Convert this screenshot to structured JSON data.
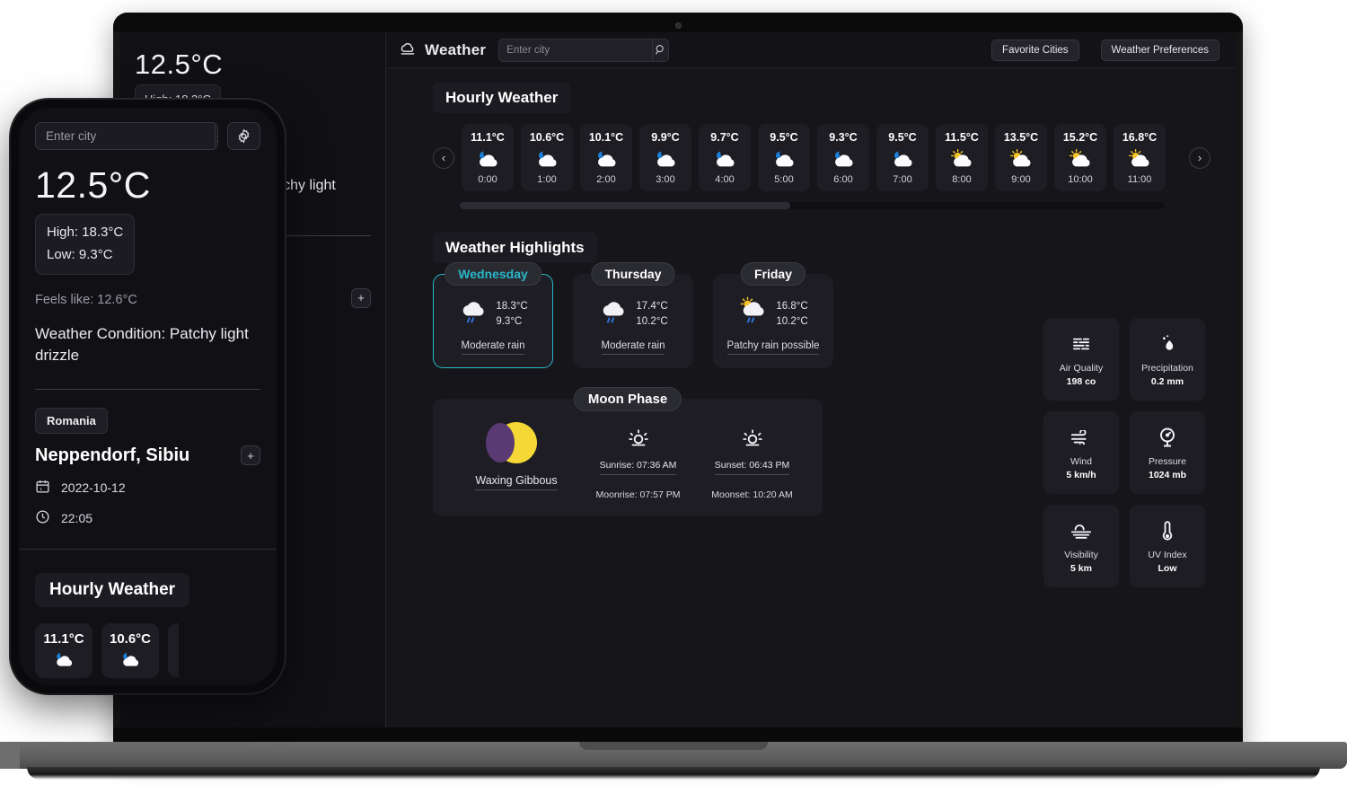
{
  "app": {
    "brand": "Weather",
    "brand_icon": "cloud-icon",
    "search": {
      "placeholder": "Enter city",
      "value": "",
      "icon": "search-icon"
    },
    "buttons": {
      "favorite_cities": "Favorite Cities",
      "weather_preferences": "Weather Preferences"
    }
  },
  "sidebar": {
    "temperature": "12.5°C",
    "high": "High: 18.3°C",
    "low": "Low: 9.3°C",
    "feels_like": "Feels like: 12.6°C",
    "condition": "Weather Condition: Patchy light drizzle",
    "country": "Romania",
    "city": "Neppendorf, Sibiu",
    "add_label": "+",
    "date": "2022-10-12",
    "time": "22:05",
    "calendar_icon": "calendar-icon",
    "clock_icon": "clock-icon"
  },
  "hourly": {
    "title": "Hourly Weather",
    "prev_label": "‹",
    "next_label": "›",
    "scroll_percent": 47,
    "items": [
      {
        "temp": "11.1°C",
        "time": "0:00",
        "icon": "moon-cloud-icon"
      },
      {
        "temp": "10.6°C",
        "time": "1:00",
        "icon": "moon-cloud-icon"
      },
      {
        "temp": "10.1°C",
        "time": "2:00",
        "icon": "moon-cloud-icon"
      },
      {
        "temp": "9.9°C",
        "time": "3:00",
        "icon": "moon-cloud-icon"
      },
      {
        "temp": "9.7°C",
        "time": "4:00",
        "icon": "moon-cloud-icon"
      },
      {
        "temp": "9.5°C",
        "time": "5:00",
        "icon": "moon-cloud-icon"
      },
      {
        "temp": "9.3°C",
        "time": "6:00",
        "icon": "moon-cloud-icon"
      },
      {
        "temp": "9.5°C",
        "time": "7:00",
        "icon": "moon-cloud-icon"
      },
      {
        "temp": "11.5°C",
        "time": "8:00",
        "icon": "sun-cloud-icon"
      },
      {
        "temp": "13.5°C",
        "time": "9:00",
        "icon": "sun-cloud-icon"
      },
      {
        "temp": "15.2°C",
        "time": "10:00",
        "icon": "sun-cloud-icon"
      },
      {
        "temp": "16.8°C",
        "time": "11:00",
        "icon": "sun-cloud-icon"
      }
    ]
  },
  "highlights": {
    "title": "Weather Highlights",
    "days": [
      {
        "name": "Wednesday",
        "high": "18.3°C",
        "low": "9.3°C",
        "condition": "Moderate rain",
        "icon": "rain-cloud-icon",
        "selected": true
      },
      {
        "name": "Thursday",
        "high": "17.4°C",
        "low": "10.2°C",
        "condition": "Moderate rain",
        "icon": "rain-cloud-icon",
        "selected": false
      },
      {
        "name": "Friday",
        "high": "16.8°C",
        "low": "10.2°C",
        "condition": "Patchy rain possible",
        "icon": "sun-rain-cloud-icon",
        "selected": false
      }
    ],
    "accent_color": "#2ab7c9"
  },
  "moon": {
    "title": "Moon Phase",
    "phase": "Waxing Gibbous",
    "phase_icon": "waxing-gibbous-icon",
    "sunrise": "Sunrise: 07:36 AM",
    "sunset": "Sunset: 06:43 PM",
    "moonrise": "Moonrise: 07:57 PM",
    "moonset": "Moonset: 10:20 AM",
    "sunrise_icon": "sunrise-icon",
    "sunset_icon": "sunset-icon"
  },
  "metrics": [
    {
      "label": "Air Quality",
      "value": "198 co",
      "icon": "air-quality-icon"
    },
    {
      "label": "Precipitation",
      "value": "0.2 mm",
      "icon": "droplet-icon"
    },
    {
      "label": "Wind",
      "value": "5 km/h",
      "icon": "wind-icon"
    },
    {
      "label": "Pressure",
      "value": "1024 mb",
      "icon": "gauge-icon"
    },
    {
      "label": "Visibility",
      "value": "5 km",
      "icon": "visibility-icon"
    },
    {
      "label": "UV Index",
      "value": "Low",
      "icon": "thermometer-icon"
    }
  ],
  "phone": {
    "search": {
      "placeholder": "Enter city",
      "value": "",
      "icon": "search-icon"
    },
    "settings_icon": "gear-icon",
    "temperature": "12.5°C",
    "high": "High: 18.3°C",
    "low": "Low: 9.3°C",
    "feels_like": "Feels like: 12.6°C",
    "condition": "Weather Condition: Patchy light drizzle",
    "country": "Romania",
    "city": "Neppendorf, Sibiu",
    "add_label": "+",
    "date": "2022-10-12",
    "time": "22:05",
    "hourly_title": "Hourly Weather",
    "hours": [
      {
        "temp": "11.1°C",
        "icon": "moon-cloud-icon"
      },
      {
        "temp": "10.6°C",
        "icon": "moon-cloud-icon"
      }
    ]
  },
  "colors": {
    "app_bg": "#16161a",
    "card_bg": "#1d1d23",
    "accent": "#2ab7c9",
    "moon_yellow": "#f5d836",
    "moon_purple": "#5a3a72"
  }
}
